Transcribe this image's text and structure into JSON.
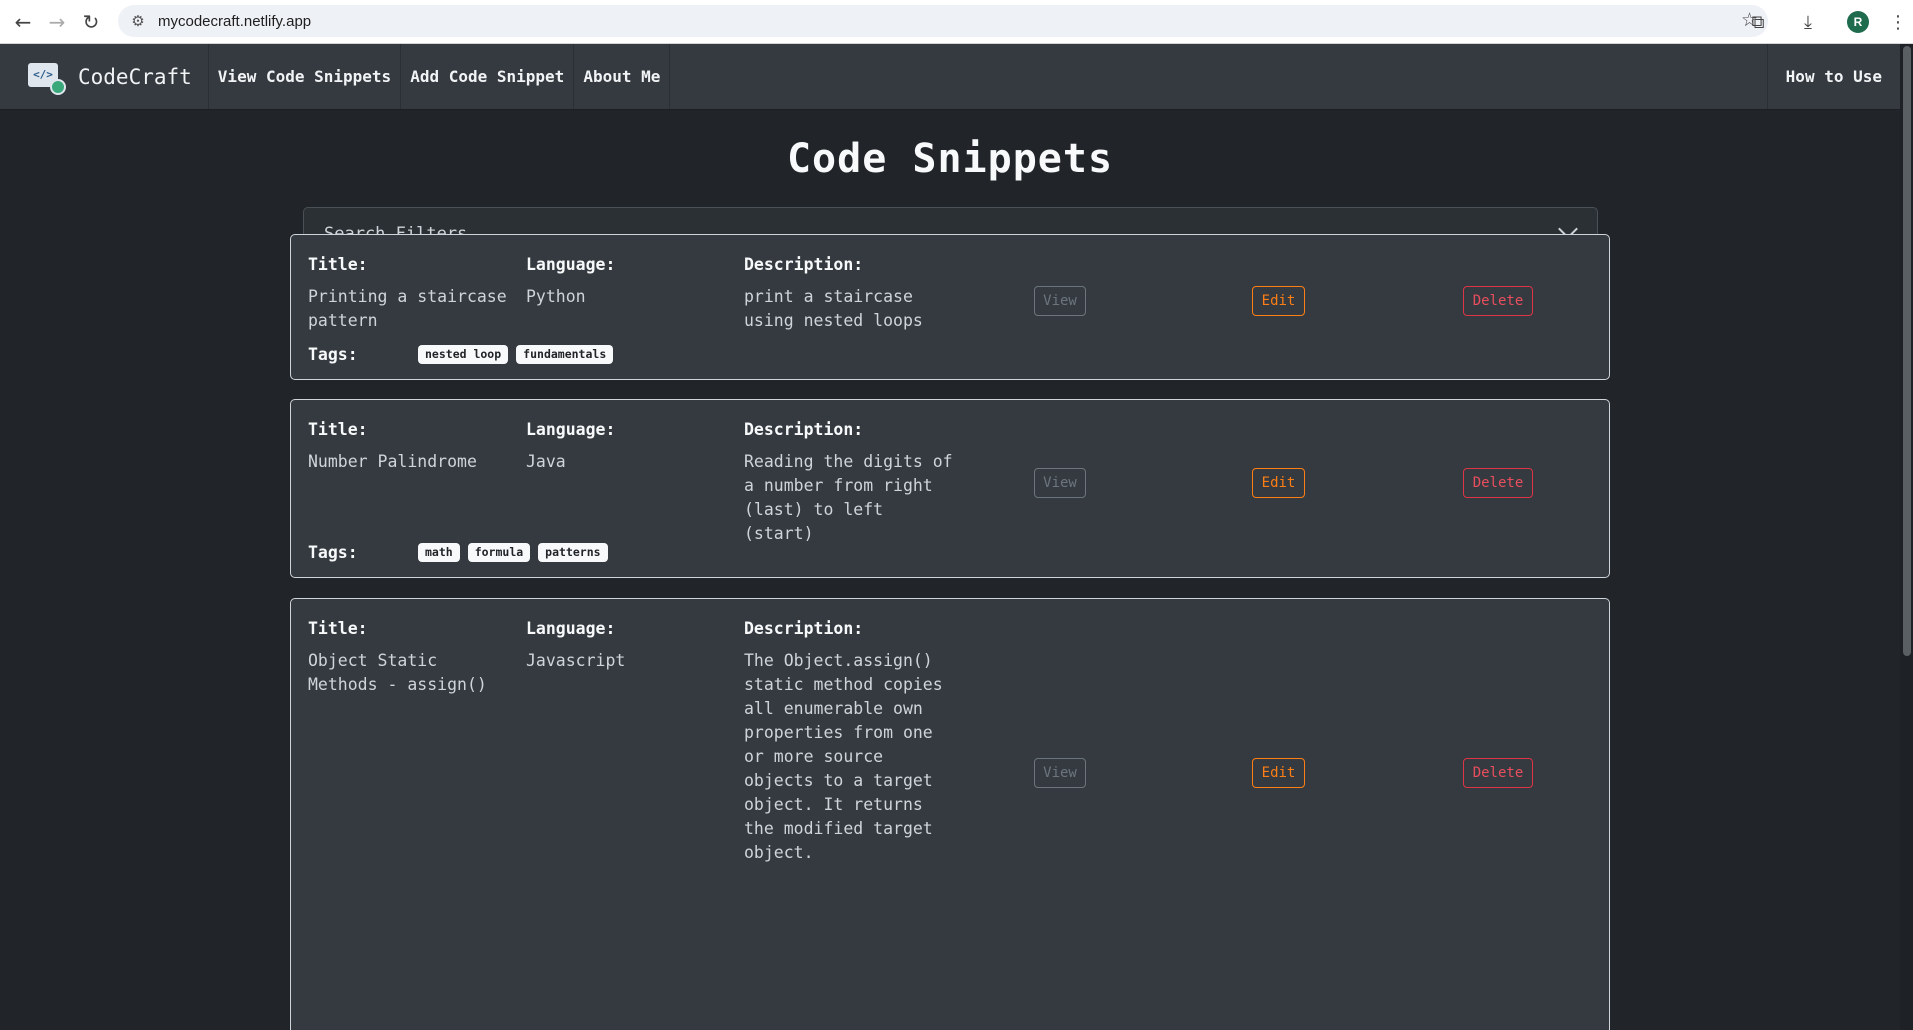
{
  "browser": {
    "url": "mycodecraft.netlify.app",
    "avatar_initial": "R"
  },
  "navbar": {
    "brand": "CodeCraft",
    "links": [
      "View Code Snippets",
      "Add Code Snippet",
      "About Me"
    ],
    "right_link": "How to Use"
  },
  "page": {
    "title": "Code Snippets",
    "filters_label": "Search Filters"
  },
  "labels": {
    "title": "Title:",
    "language": "Language:",
    "description": "Description:",
    "tags": "Tags:",
    "view": "View",
    "edit": "Edit",
    "delete": "Delete"
  },
  "snippets": [
    {
      "title": "Printing a staircase pattern",
      "language": "Python",
      "description": "print a staircase using nested loops",
      "tags": [
        "nested loop",
        "fundamentals"
      ]
    },
    {
      "title": "Number Palindrome",
      "language": "Java",
      "description": "Reading the digits of a number from right (last) to left (start)",
      "tags": [
        "math",
        "formula",
        "patterns"
      ]
    },
    {
      "title": "Object Static Methods - assign()",
      "language": "Javascript",
      "description": "The Object.assign() static method copies all enumerable own properties from one or more source objects to a target object. It returns the modified target object.",
      "tags": []
    }
  ],
  "colors": {
    "background": "#212529",
    "navbar": "#343a40",
    "edit": "#fd7e14",
    "delete": "#dc3545",
    "view": "#6c757d"
  }
}
